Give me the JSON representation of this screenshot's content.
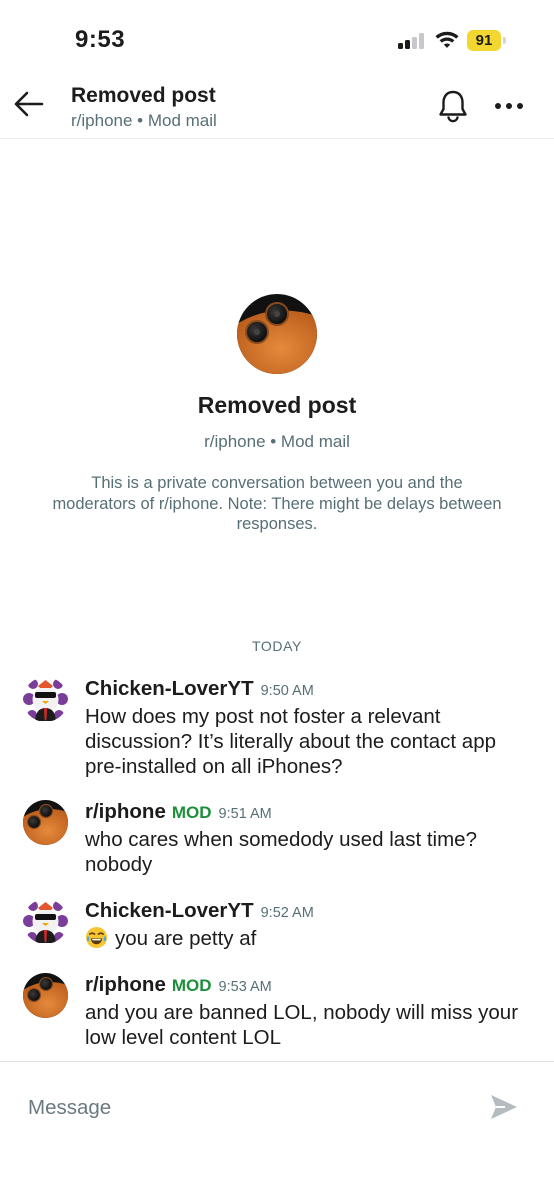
{
  "status_bar": {
    "time": "9:53",
    "battery": "91"
  },
  "header": {
    "title": "Removed post",
    "subtitle": "r/iphone • Mod mail"
  },
  "intro": {
    "title": "Removed post",
    "subtitle": "r/iphone • Mod mail",
    "description": "This is a private conversation between you and the moderators of r/iphone. Note: There might be delays between responses."
  },
  "day_separator": "TODAY",
  "messages": [
    {
      "author": "Chicken-LoverYT",
      "badge": "",
      "time": "9:50 AM",
      "emoji": "",
      "text": "How does my post not foster a relevant discussion? It’s literally about the contact app pre-installed on all iPhones?",
      "avatar": "user-avatar"
    },
    {
      "author": "r/iphone",
      "badge": "MOD",
      "time": "9:51 AM",
      "emoji": "",
      "text": "who cares when somedody used last time? nobody",
      "avatar": "subreddit-avatar"
    },
    {
      "author": "Chicken-LoverYT",
      "badge": "",
      "time": "9:52 AM",
      "emoji": "tears-of-joy-emoji",
      "text": "you are petty af",
      "avatar": "user-avatar"
    },
    {
      "author": "r/iphone",
      "badge": "MOD",
      "time": "9:53 AM",
      "emoji": "",
      "text": "and you are banned LOL, nobody will miss your low level content LOL",
      "avatar": "subreddit-avatar"
    }
  ],
  "composer": {
    "placeholder": "Message"
  },
  "colors": {
    "mod_badge": "#1d8f3a",
    "battery": "#f4d630",
    "muted_text": "#576f76"
  },
  "icons": {
    "back": "back-arrow-icon",
    "bell": "bell-icon",
    "more": "more-icon",
    "send": "send-icon",
    "signal": "signal-icon",
    "wifi": "wifi-icon",
    "battery": "battery-icon"
  }
}
